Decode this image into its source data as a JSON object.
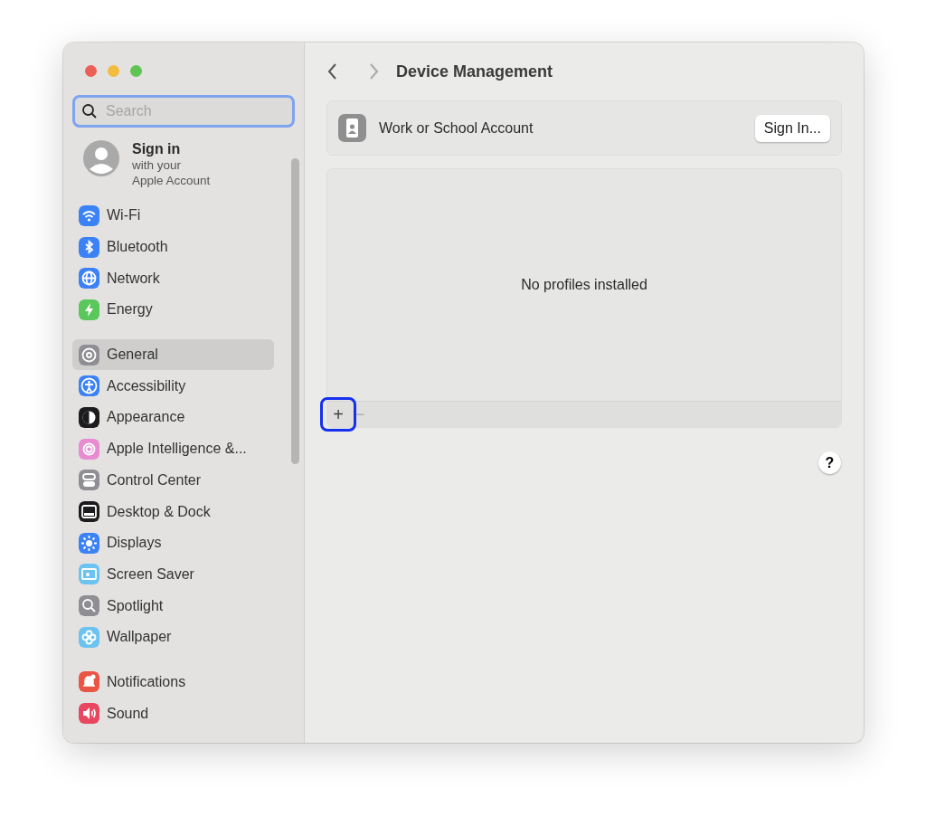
{
  "window": {
    "title": "Device Management"
  },
  "search": {
    "placeholder": "Search",
    "focused": true
  },
  "account": {
    "title": "Sign in",
    "subtitle_lines": [
      "with your",
      "Apple Account"
    ]
  },
  "sidebar": {
    "groups": [
      [
        {
          "label": "Wi-Fi",
          "kind": "wifi",
          "color": "#3b82f6",
          "selected": false
        },
        {
          "label": "Bluetooth",
          "kind": "bluetooth",
          "color": "#3b82f6",
          "selected": false
        },
        {
          "label": "Network",
          "kind": "globe",
          "color": "#3b82f6",
          "selected": false
        },
        {
          "label": "Energy",
          "kind": "bolt",
          "color": "#5ac75a",
          "selected": false
        }
      ],
      [
        {
          "label": "General",
          "kind": "gear",
          "color": "#8e8e93",
          "selected": true
        },
        {
          "label": "Accessibility",
          "kind": "person",
          "color": "#3b82f6",
          "selected": false
        },
        {
          "label": "Appearance",
          "kind": "contrast",
          "color": "#1c1c1e",
          "selected": false
        },
        {
          "label": "Apple Intelligence &...",
          "kind": "sparkle",
          "color": "#e98bd0",
          "selected": false
        },
        {
          "label": "Control Center",
          "kind": "toggles",
          "color": "#8e8e93",
          "selected": false
        },
        {
          "label": "Desktop & Dock",
          "kind": "dock",
          "color": "#1c1c1e",
          "selected": false
        },
        {
          "label": "Displays",
          "kind": "sun",
          "color": "#3b82f6",
          "selected": false
        },
        {
          "label": "Screen Saver",
          "kind": "screen",
          "color": "#6cc3ef",
          "selected": false
        },
        {
          "label": "Spotlight",
          "kind": "search",
          "color": "#8e8e93",
          "selected": false
        },
        {
          "label": "Wallpaper",
          "kind": "flower",
          "color": "#6cc3ef",
          "selected": false
        }
      ],
      [
        {
          "label": "Notifications",
          "kind": "bell",
          "color": "#eb5545",
          "selected": false
        },
        {
          "label": "Sound",
          "kind": "speaker",
          "color": "#e8475f",
          "selected": false
        }
      ]
    ]
  },
  "account_card": {
    "label": "Work or School Account",
    "button": "Sign In..."
  },
  "profiles": {
    "empty_text": "No profiles installed",
    "add_button": {
      "label": "+",
      "focused": true
    },
    "remove_button": {
      "label": "−",
      "disabled": true
    }
  },
  "help_button": "?"
}
